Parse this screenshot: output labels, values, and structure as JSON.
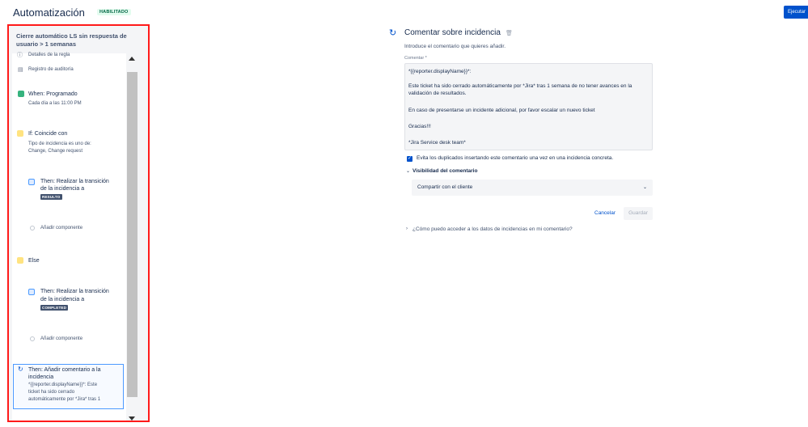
{
  "header": {
    "title": "Automatización",
    "status": "HABILITADO",
    "run_label": "Ejecutar"
  },
  "rule": {
    "name": "Cierre automático LS sin respuesta de usuario > 1 semanas",
    "details_label": "Detalles de la regla",
    "audit_label": "Registro de auditoría",
    "trigger_title": "When: Programado",
    "trigger_sub": "Cada día a las 11:00 PM",
    "condition_title": "If: Coincide con",
    "condition_sub1": "Tipo de incidencia es uno de:",
    "condition_sub2": "Change, Change request",
    "then1_line1": "Then: Realizar la transición",
    "then1_line2": "de la incidencia a",
    "then1_status": "RESULTO",
    "add_component_1": "Añadir componente",
    "else_label": "Else",
    "then2_line1": "Then: Realizar la transición",
    "then2_line2": "de la incidencia a",
    "then2_status": "COMPLETED",
    "add_component_2": "Añadir componente",
    "selected_line1": "Then: Añadir comentario a la",
    "selected_line2": "incidencia",
    "selected_line3": "*{{reporter.displayName}}*: Este",
    "selected_line4": "ticket ha sido cerrado",
    "selected_line5": "automáticamente por *Jira* tras 1"
  },
  "editor": {
    "title": "Comentar sobre incidencia",
    "description": "Introduce el comentario que quieres añadir.",
    "comment_label": "Comentar *",
    "comment_lines": [
      "*{{reporter.displayName}}*:",
      "Este ticket ha sido cerrado automáticamente por *Jira* tras 1 semana de no tener avances en la",
      "validación de resultados.",
      "En caso de presentarse un incidente adicional, por favor escalar un nuevo ticket",
      "Gracias!!!",
      "*Jira Service desk team*"
    ],
    "dedupe_label": "Evita los duplicados insertando este comentario una vez en una incidencia concreta.",
    "visibility_title": "Visibilidad del comentario",
    "visibility_value": "Compartir con el cliente",
    "cancel_label": "Cancelar",
    "save_label": "Guardar",
    "help_link": "¿Cómo puedo acceder a los datos de incidencias en mi comentario?"
  },
  "colors": {
    "accent": "#0052cc",
    "highlight_outline": "#ff1a1a",
    "status_green": "#36b37e",
    "condition_yellow": "#ffe380"
  },
  "icons": {
    "trigger": "calendar-icon",
    "condition": "branch-icon",
    "action": "transition-icon",
    "comment": "refresh-comment-icon"
  }
}
